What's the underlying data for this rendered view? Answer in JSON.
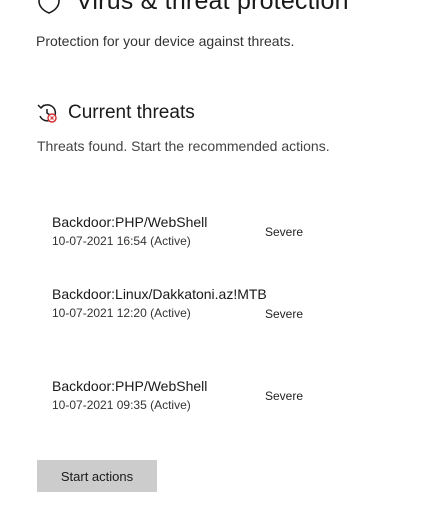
{
  "page": {
    "title": "Virus & threat protection",
    "subtitle": "Protection for your device against threats.",
    "icon": "shield-icon"
  },
  "current_threats": {
    "title": "Current threats",
    "description": "Threats found. Start the recommended actions.",
    "icon": "threat-history-icon",
    "threats": [
      {
        "name": "Backdoor:PHP/WebShell",
        "date": "10-07-2021 16:54 (Active)",
        "severity": "Severe"
      },
      {
        "name": "Backdoor:Linux/Dakkatoni.az!MTB",
        "date": "10-07-2021 12:20 (Active)",
        "severity": "Severe"
      },
      {
        "name": "Backdoor:PHP/WebShell",
        "date": "10-07-2021 09:35 (Active)",
        "severity": "Severe"
      }
    ],
    "action_button": "Start actions"
  },
  "colors": {
    "accent_red": "#d13438",
    "button_bg": "#cccccc"
  }
}
